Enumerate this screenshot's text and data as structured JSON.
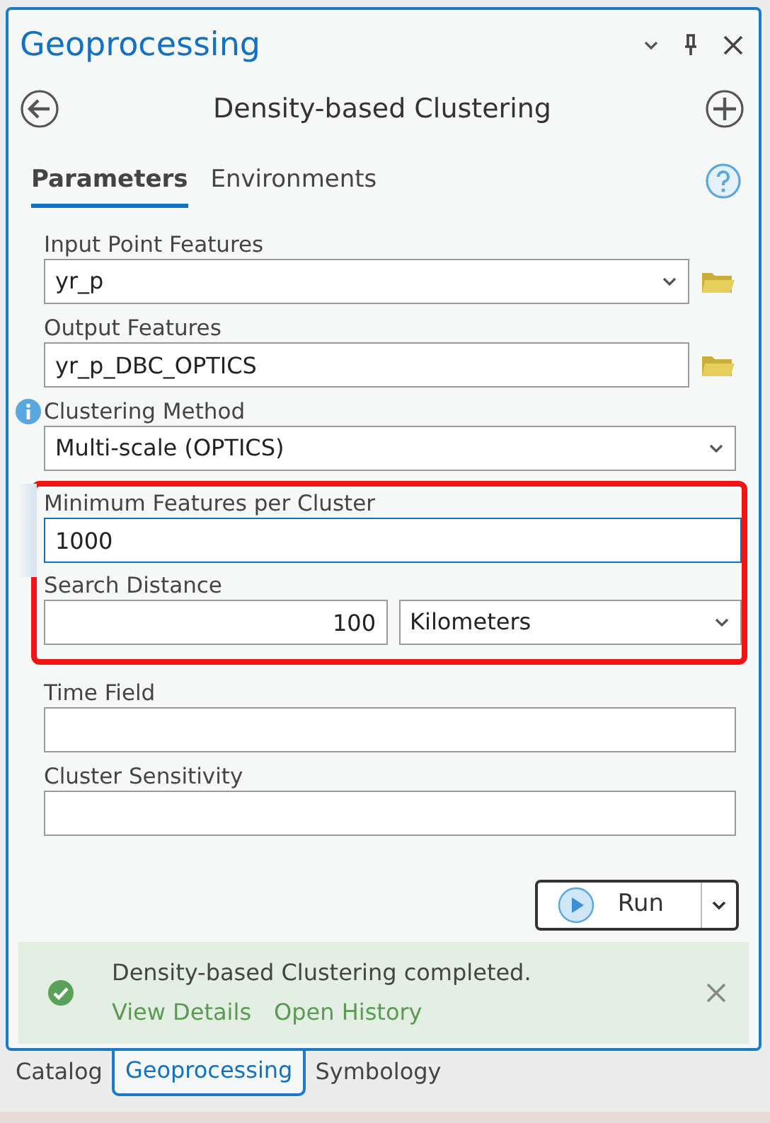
{
  "pane": {
    "title": "Geoprocessing"
  },
  "tool": {
    "title": "Density-based Clustering"
  },
  "tabs": [
    {
      "label": "Parameters",
      "selected": true
    },
    {
      "label": "Environments",
      "selected": false
    }
  ],
  "parameters": [
    {
      "label": "Input Point Features",
      "kind": "select",
      "value": "yr_p",
      "browse": true,
      "info": false,
      "focused": false,
      "highlighted": false
    },
    {
      "label": "Output Features",
      "kind": "text",
      "value": "yr_p_DBC_OPTICS",
      "browse": true,
      "info": false,
      "focused": false,
      "highlighted": false
    },
    {
      "label": "Clustering Method",
      "kind": "select",
      "value": "Multi-scale (OPTICS)",
      "browse": false,
      "info": true,
      "focused": false,
      "highlighted": false
    },
    {
      "label": "Minimum Features per Cluster",
      "kind": "text",
      "value": "1000",
      "browse": false,
      "info": false,
      "focused": true,
      "highlighted": true
    },
    {
      "label": "Search Distance",
      "kind": "distance",
      "value": "100",
      "unit": "Kilometers",
      "browse": false,
      "info": false,
      "focused": false,
      "highlighted": true
    },
    {
      "label": "Time Field",
      "kind": "text",
      "browse": false,
      "info": false,
      "focused": false,
      "highlighted": false
    },
    {
      "label": "Cluster Sensitivity",
      "kind": "text",
      "browse": false,
      "info": false,
      "focused": false,
      "highlighted": false
    }
  ],
  "run_button": {
    "label": "Run"
  },
  "message": {
    "text": "Density-based Clustering completed.",
    "links": [
      "View Details",
      "Open History"
    ]
  },
  "bottom_tabs": [
    {
      "label": "Catalog",
      "selected": false
    },
    {
      "label": "Geoprocessing",
      "selected": true
    },
    {
      "label": "Symbology",
      "selected": false
    }
  ]
}
